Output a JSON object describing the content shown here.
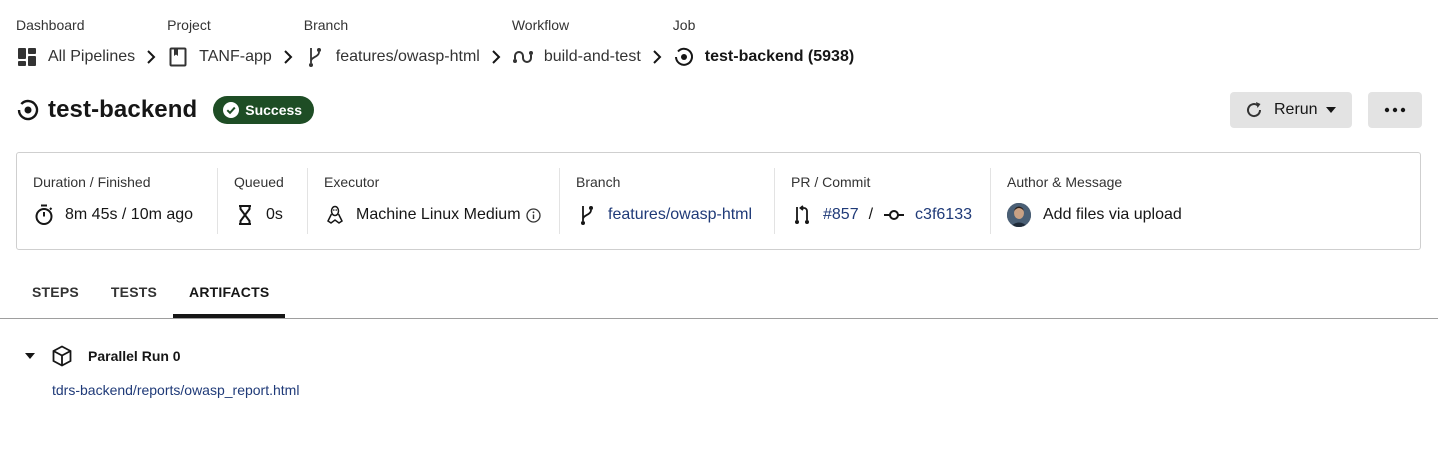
{
  "breadcrumb": [
    {
      "label": "Dashboard",
      "value": "All Pipelines",
      "icon": "dashboard-icon"
    },
    {
      "label": "Project",
      "value": "TANF-app",
      "icon": "project-icon"
    },
    {
      "label": "Branch",
      "value": "features/owasp-html",
      "icon": "branch-icon"
    },
    {
      "label": "Workflow",
      "value": "build-and-test",
      "icon": "workflow-icon"
    },
    {
      "label": "Job",
      "value": "test-backend (5938)",
      "icon": "job-icon"
    }
  ],
  "header": {
    "title": "test-backend",
    "status": "Success",
    "rerun_label": "Rerun"
  },
  "info": {
    "duration": {
      "label": "Duration / Finished",
      "value": "8m 45s / 10m ago"
    },
    "queued": {
      "label": "Queued",
      "value": "0s"
    },
    "executor": {
      "label": "Executor",
      "value": "Machine Linux Medium"
    },
    "branch": {
      "label": "Branch",
      "value": "features/owasp-html"
    },
    "pr_commit": {
      "label": "PR / Commit",
      "pr": "#857",
      "separator": "/",
      "commit": "c3f6133"
    },
    "author": {
      "label": "Author & Message",
      "message": "Add files via upload"
    }
  },
  "tabs": [
    {
      "label": "STEPS",
      "active": false
    },
    {
      "label": "TESTS",
      "active": false
    },
    {
      "label": "ARTIFACTS",
      "active": true
    }
  ],
  "artifacts": {
    "group_label": "Parallel Run 0",
    "items": [
      "tdrs-backend/reports/owasp_report.html"
    ]
  },
  "colors": {
    "success": "#1e4d25",
    "link": "#1f3a78",
    "button_bg": "#e3e3e3"
  }
}
